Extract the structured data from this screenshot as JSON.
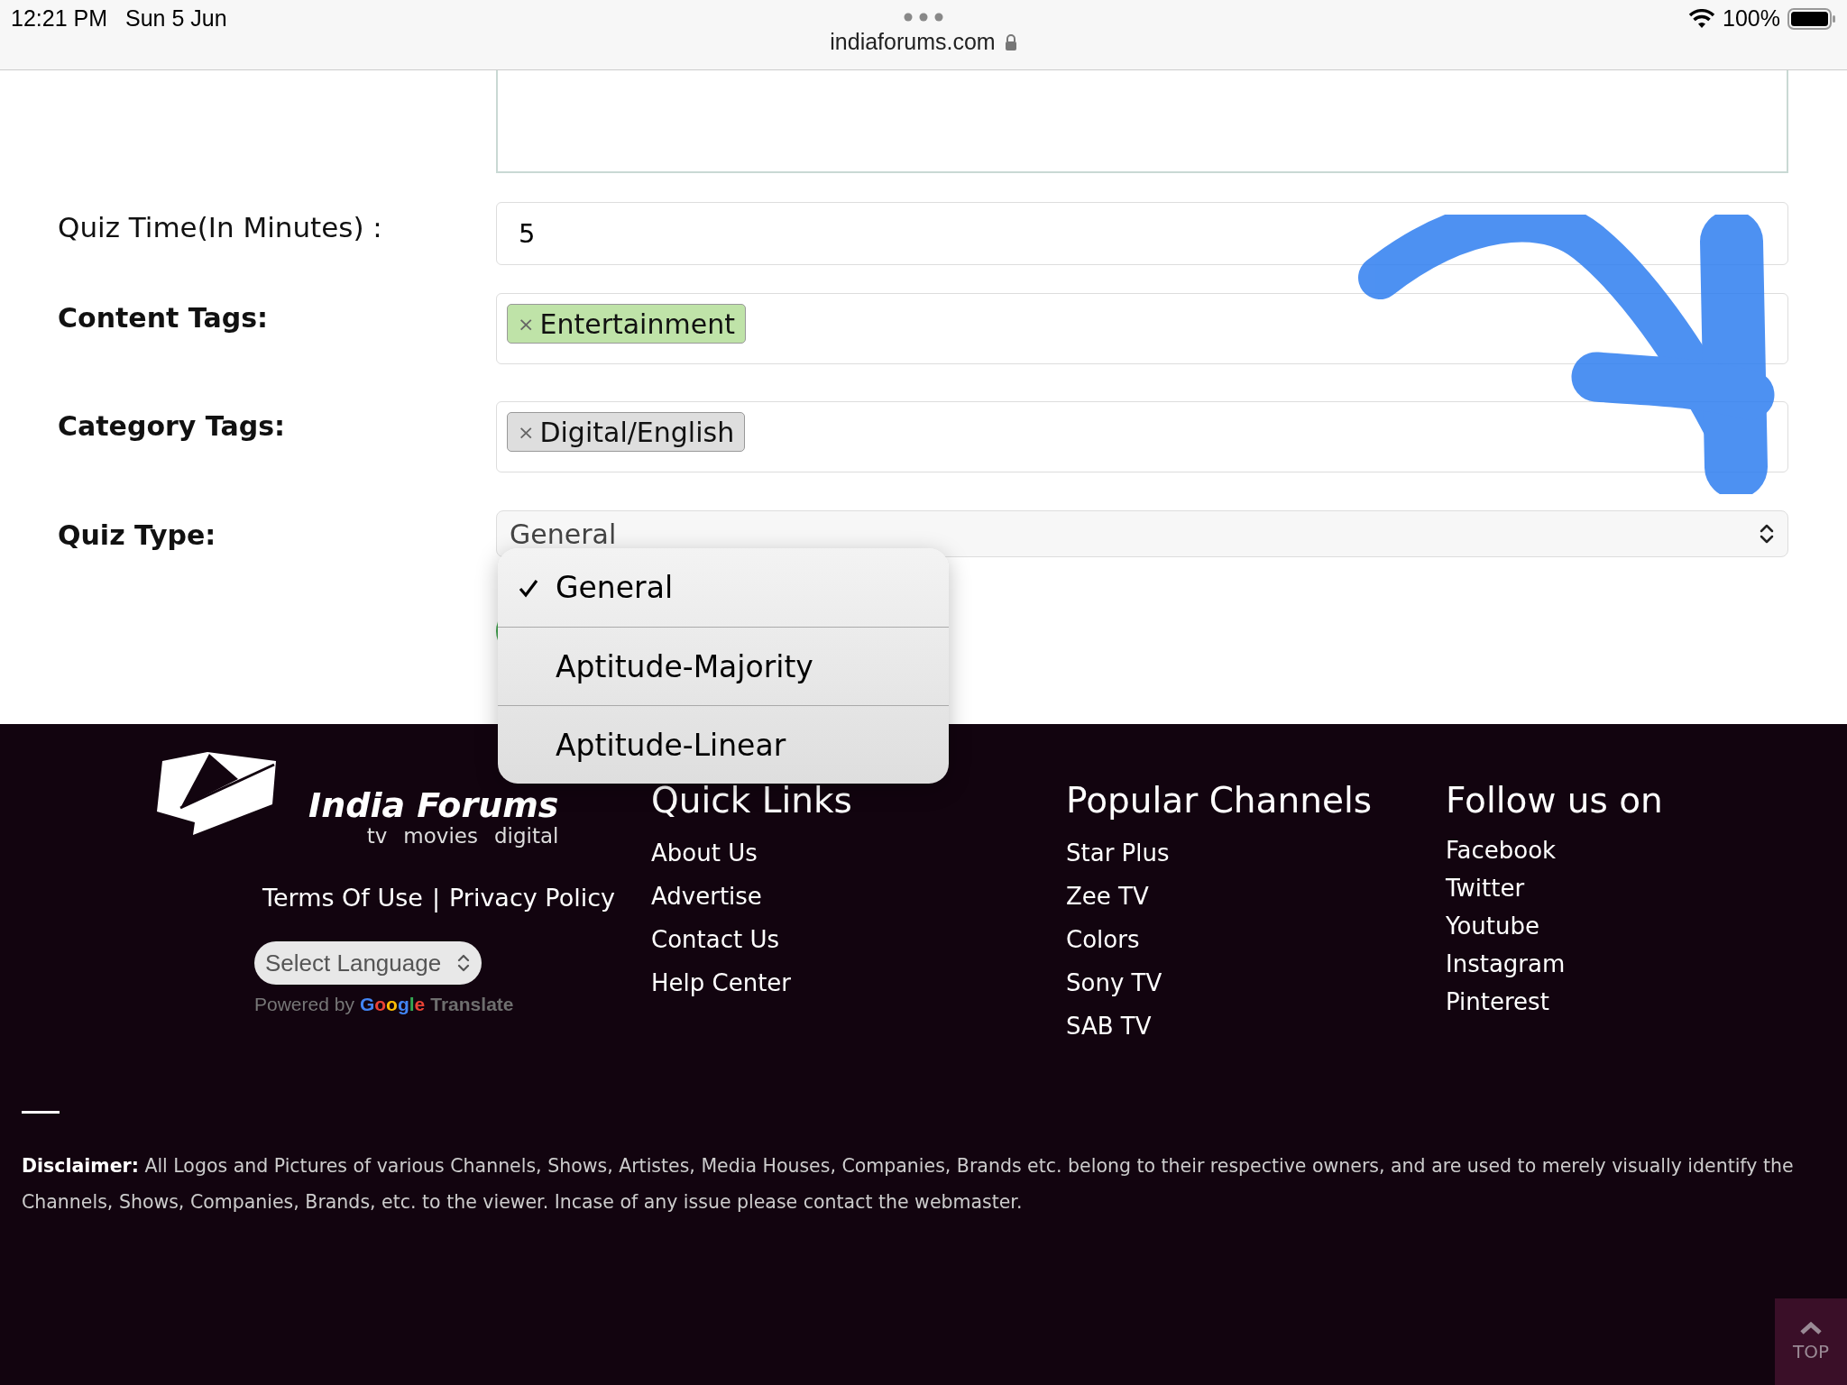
{
  "status_bar": {
    "time": "12:21 PM",
    "date": "Sun 5 Jun",
    "url": "indiaforums.com",
    "battery": "100%"
  },
  "form": {
    "fields": [
      {
        "label": "Quiz Time(In Minutes) :",
        "emphasis": false,
        "kind": "text",
        "value": "5"
      },
      {
        "label": "Content Tags:",
        "emphasis": true,
        "kind": "tags",
        "tags": [
          {
            "remove": "×",
            "text": "Entertainment",
            "color": "#bfe3a8"
          }
        ]
      },
      {
        "label": "Category Tags:",
        "emphasis": true,
        "kind": "tags",
        "tags": [
          {
            "remove": "×",
            "text": "Digital/English",
            "color": "#dedede"
          }
        ]
      },
      {
        "label": "Quiz Type:",
        "emphasis": true,
        "kind": "select",
        "value": "General"
      }
    ]
  },
  "dropdown": {
    "options": [
      {
        "label": "General",
        "selected": true
      },
      {
        "label": "Aptitude-Majority",
        "selected": false
      },
      {
        "label": "Aptitude-Linear",
        "selected": false
      }
    ]
  },
  "footer": {
    "logo": {
      "title": "India Forums",
      "tagline": [
        "tv",
        "movies",
        "digital"
      ]
    },
    "legal": [
      "Terms Of Use",
      "|",
      "Privacy Policy"
    ],
    "language_select": "Select Language",
    "powered_by": {
      "prefix": "Powered by",
      "brand": "Google",
      "product": "Translate"
    },
    "columns": [
      {
        "heading": "Quick Links",
        "links": [
          "About Us",
          "Advertise",
          "Contact Us",
          "Help Center"
        ]
      },
      {
        "heading": "Popular Channels",
        "links": [
          "Star Plus",
          "Zee TV",
          "Colors",
          "Sony TV",
          "SAB TV"
        ]
      },
      {
        "heading": "Follow us on",
        "links": [
          "Facebook",
          "Twitter",
          "Youtube",
          "Instagram",
          "Pinterest"
        ]
      }
    ],
    "disclaimer": "**Disclaimer:** All Logos and Pictures of various Channels, Shows, Artistes, Media Houses, Companies, Brands etc. belong to their respective owners, and are used to merely visually identify the Channels, Shows, Companies, Brands, etc. to the viewer. Incase of any issue please contact the webmaster.",
    "top_button": "TOP"
  }
}
